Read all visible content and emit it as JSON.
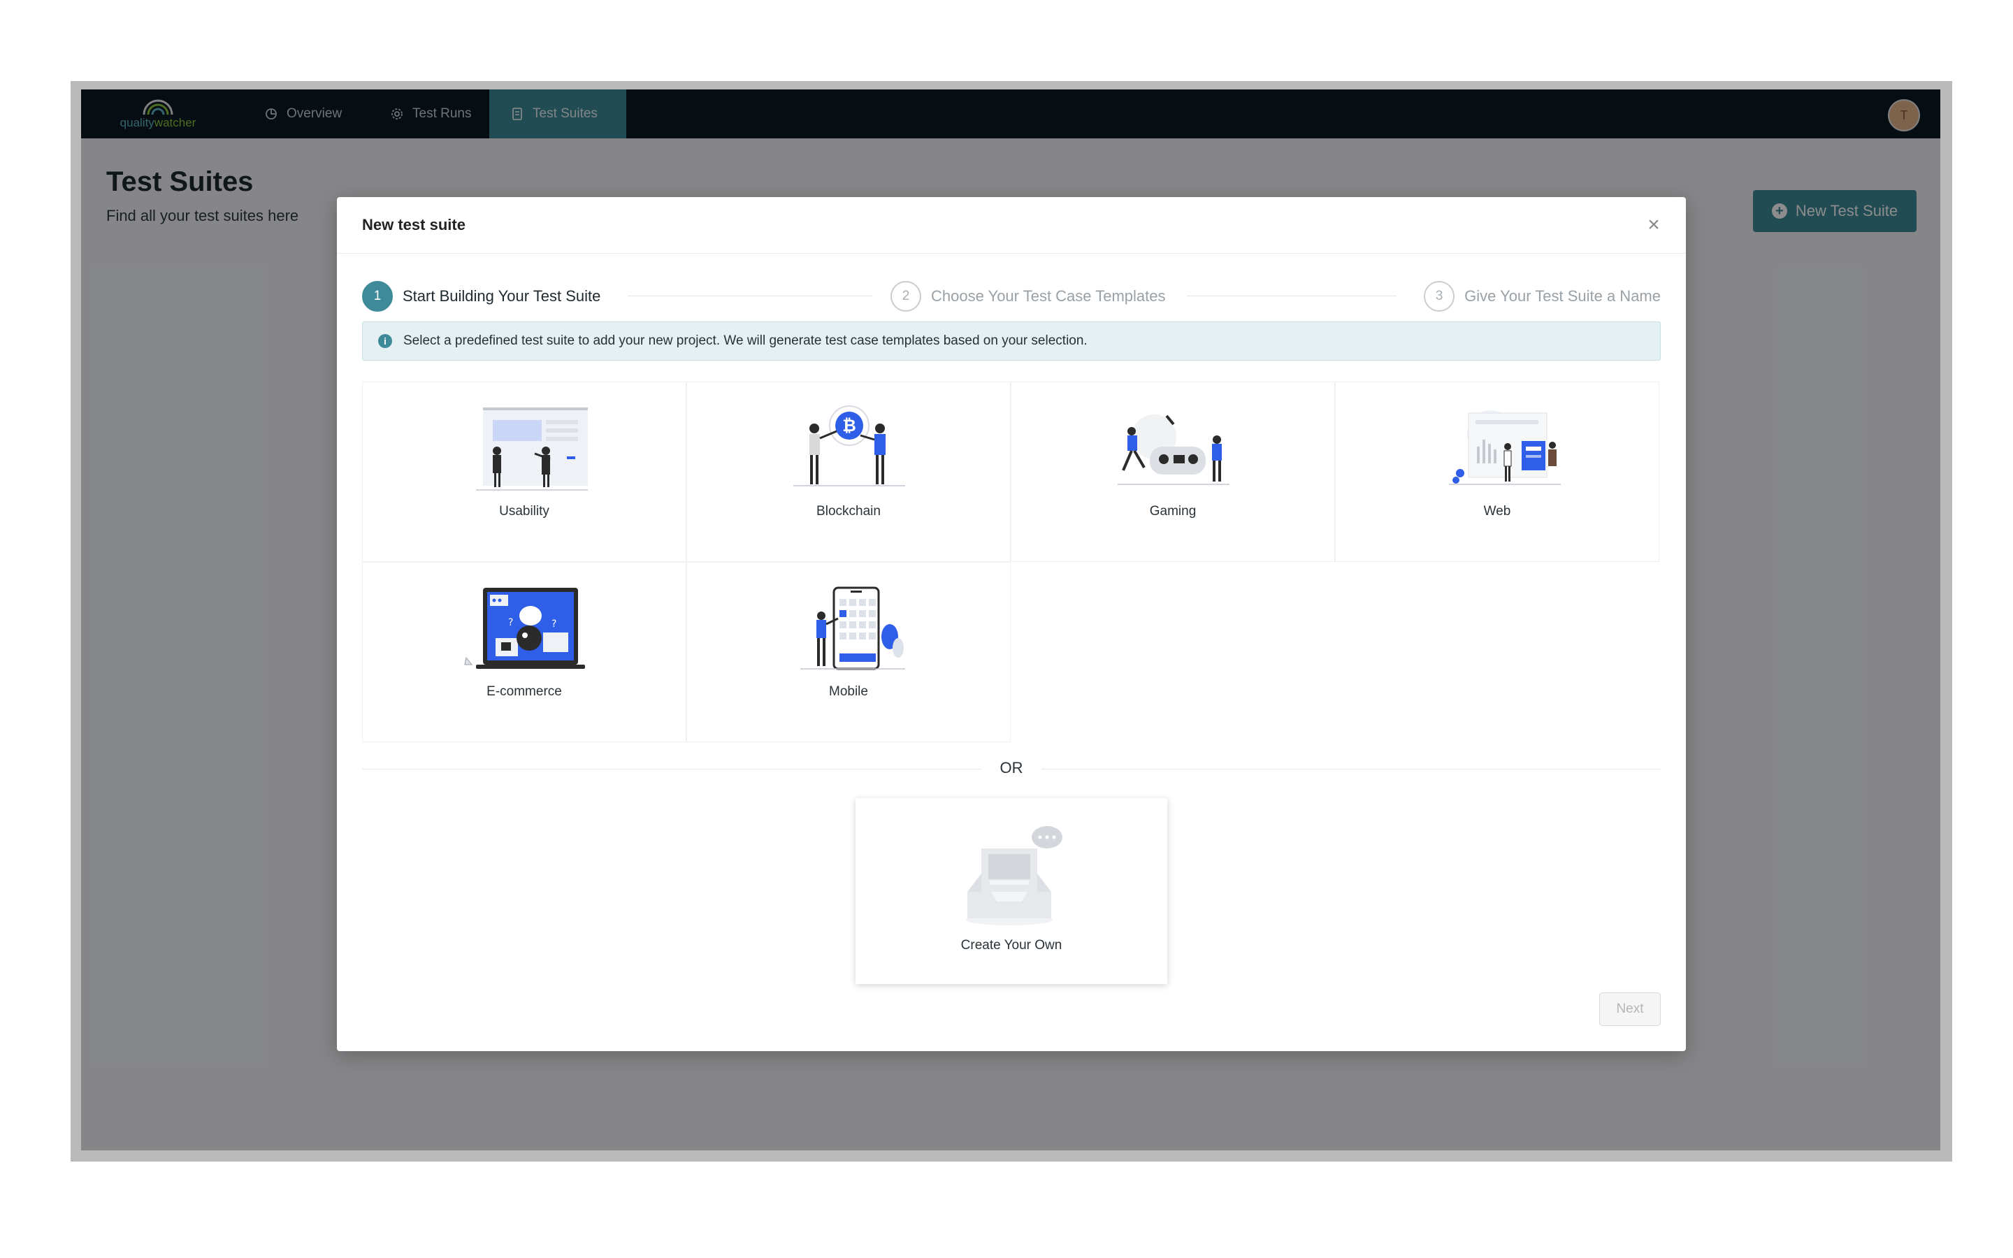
{
  "app": {
    "logo_text_prefix": "quality",
    "logo_text_suffix": "watcher",
    "avatar_initial": "T"
  },
  "nav": {
    "items": [
      {
        "label": "Overview",
        "icon": "chart-pie-icon"
      },
      {
        "label": "Test Runs",
        "icon": "gear-icon"
      },
      {
        "label": "Test Suites",
        "icon": "document-icon",
        "active": true
      }
    ]
  },
  "page": {
    "title": "Test Suites",
    "subtitle": "Find all your test suites here",
    "new_button": "New Test Suite"
  },
  "modal": {
    "title": "New test suite",
    "close": "×",
    "steps": [
      {
        "number": "1",
        "label": "Start Building Your Test Suite",
        "active": true
      },
      {
        "number": "2",
        "label": "Choose Your Test Case Templates",
        "active": false
      },
      {
        "number": "3",
        "label": "Give Your Test Suite a Name",
        "active": false
      }
    ],
    "info": "Select a predefined test suite to add your new project. We will generate test case templates based on your selection.",
    "suites": [
      {
        "label": "Usability",
        "illustration": "usability-illustration"
      },
      {
        "label": "Blockchain",
        "illustration": "blockchain-illustration"
      },
      {
        "label": "Gaming",
        "illustration": "gaming-illustration"
      },
      {
        "label": "Web",
        "illustration": "web-illustration"
      },
      {
        "label": "E-commerce",
        "illustration": "ecommerce-illustration"
      },
      {
        "label": "Mobile",
        "illustration": "mobile-illustration"
      }
    ],
    "or_label": "OR",
    "create_own": "Create Your Own",
    "next_button": "Next"
  },
  "colors": {
    "accent": "#3e8a99",
    "topbar": "#0d1b24",
    "illustration_blue": "#2f5ee8"
  }
}
